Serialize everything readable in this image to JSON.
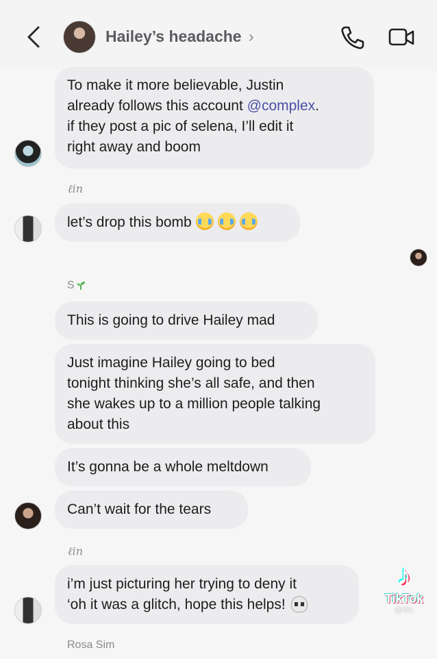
{
  "header": {
    "title": "Hailey’s headache",
    "chevron": "›",
    "back_icon": "chevron-left-icon",
    "call_icon": "phone-icon",
    "video_icon": "video-camera-icon"
  },
  "messages": [
    {
      "lines": [
        "To make it more believable, Justin",
        "already follows this account ",
        "if they post a pic of selena, I’ll edit it",
        "right away and boom"
      ],
      "mention": "@complex",
      "mention_suffix": "."
    },
    {
      "text": "let’s drop this bomb"
    },
    {
      "text": "This is going to drive Hailey mad"
    },
    {
      "lines": [
        "Just imagine Hailey going to bed",
        "tonight thinking she’s all safe, and then",
        "she wakes up to a million people talking",
        "about this"
      ]
    },
    {
      "text": "It’s gonna be a whole meltdown"
    },
    {
      "text": "Can’t wait for the tears"
    },
    {
      "lines": [
        "i’m just picturing her trying to deny it",
        "‘oh it was a glitch, hope this helps!"
      ]
    }
  ],
  "senders": {
    "lin_1": "ℓin",
    "s": "S",
    "lin_2": "ℓin",
    "rosa": "Rosa Sim"
  },
  "watermark": {
    "brand": "TikTok",
    "handle": "@l3lx"
  }
}
